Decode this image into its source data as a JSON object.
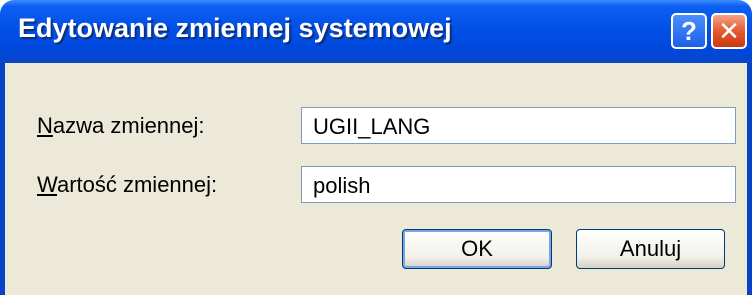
{
  "dialog": {
    "title": "Edytowanie zmiennej systemowej",
    "help_glyph": "?",
    "close_glyph": "✕"
  },
  "form": {
    "name_label_mnemonic": "N",
    "name_label_rest": "azwa zmiennej:",
    "name_value": "UGII_LANG",
    "value_label_mnemonic": "W",
    "value_label_rest": "artość zmiennej:",
    "value_value": "polish"
  },
  "buttons": {
    "ok_label": "OK",
    "cancel_label": "Anuluj"
  },
  "colors": {
    "titlebar": "#0250e7",
    "dialog_face": "#ece9d8",
    "close_button": "#e3542b"
  },
  "icons": {
    "help": "question-mark-icon",
    "close": "close-x-icon"
  }
}
